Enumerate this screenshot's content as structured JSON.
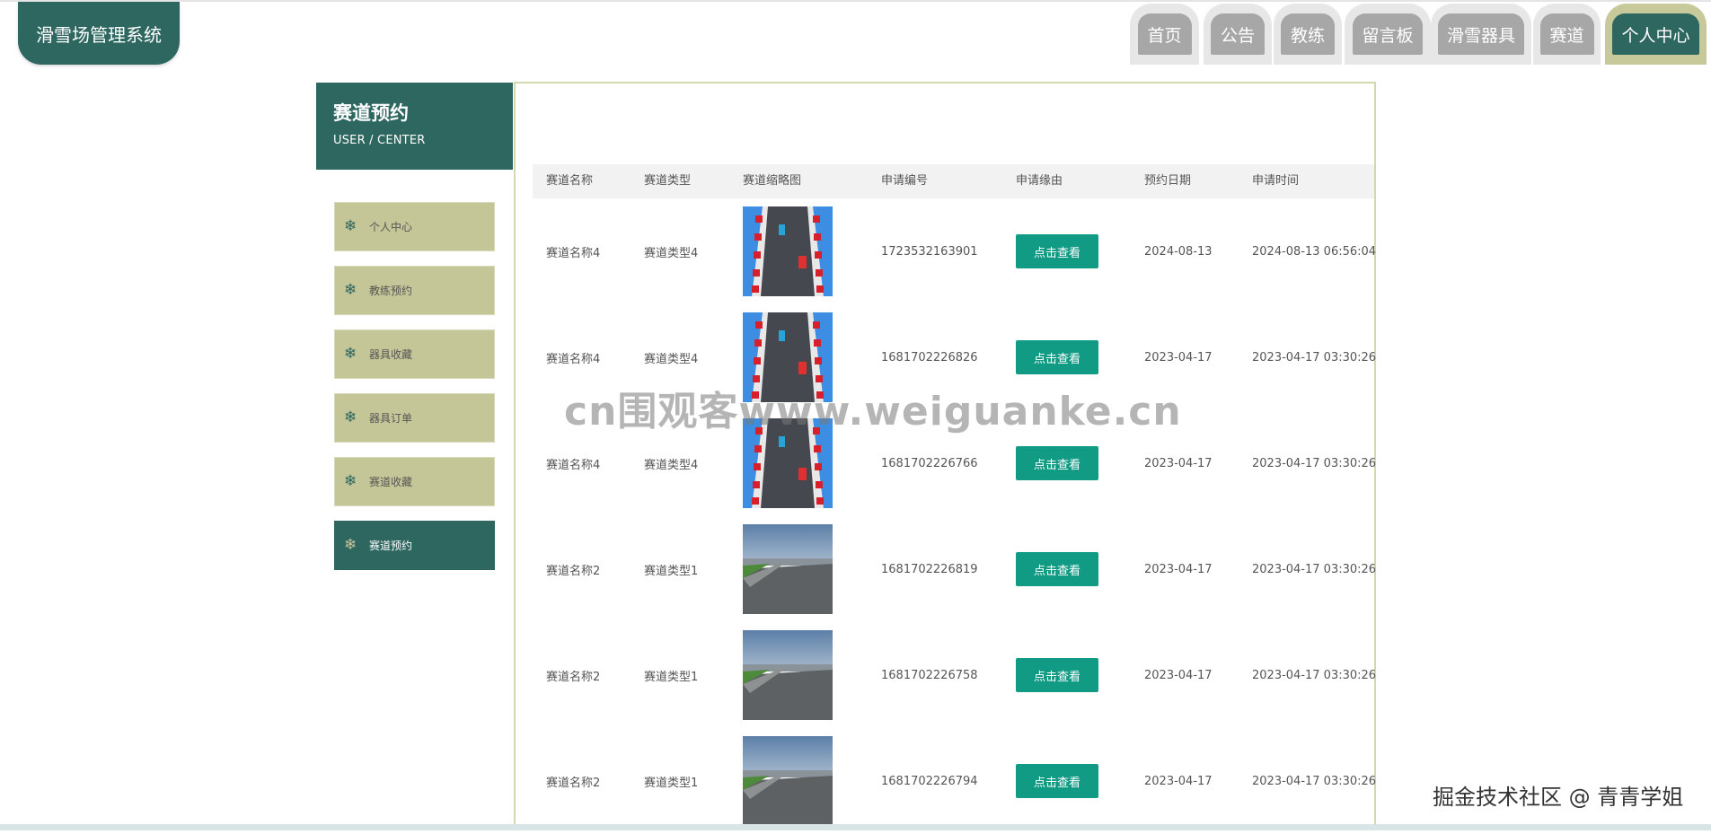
{
  "brand": {
    "title": "滑雪场管理系统"
  },
  "nav": {
    "items": [
      {
        "label": "首页"
      },
      {
        "label": "公告"
      },
      {
        "label": "教练"
      },
      {
        "label": "留言板"
      },
      {
        "label": "滑雪器具"
      },
      {
        "label": "赛道"
      },
      {
        "label": "个人中心",
        "active": true
      }
    ]
  },
  "sidebar": {
    "title": "赛道预约",
    "subtitle": "USER / CENTER",
    "icon": "snowflake-icon",
    "items": [
      {
        "label": "个人中心"
      },
      {
        "label": "教练预约"
      },
      {
        "label": "器具收藏"
      },
      {
        "label": "器具订单"
      },
      {
        "label": "赛道收藏"
      },
      {
        "label": "赛道预约",
        "active": true
      }
    ]
  },
  "table": {
    "headers": [
      "赛道名称",
      "赛道类型",
      "赛道缩略图",
      "申请编号",
      "申请缘由",
      "预约日期",
      "申请时间"
    ],
    "view_label": "点击查看",
    "rows": [
      {
        "name": "赛道名称4",
        "type": "赛道类型4",
        "thumb": "race-track-thumbnail",
        "apply_no": "1723532163901",
        "date": "2024-08-13",
        "time": "2024-08-13 06:56:04"
      },
      {
        "name": "赛道名称4",
        "type": "赛道类型4",
        "thumb": "race-track-thumbnail",
        "apply_no": "1681702226826",
        "date": "2023-04-17",
        "time": "2023-04-17 03:30:26"
      },
      {
        "name": "赛道名称4",
        "type": "赛道类型4",
        "thumb": "race-track-thumbnail",
        "apply_no": "1681702226766",
        "date": "2023-04-17",
        "time": "2023-04-17 03:30:26"
      },
      {
        "name": "赛道名称2",
        "type": "赛道类型1",
        "thumb": "circuit-photo-thumbnail",
        "apply_no": "1681702226819",
        "date": "2023-04-17",
        "time": "2023-04-17 03:30:26"
      },
      {
        "name": "赛道名称2",
        "type": "赛道类型1",
        "thumb": "circuit-photo-thumbnail",
        "apply_no": "1681702226758",
        "date": "2023-04-17",
        "time": "2023-04-17 03:30:26"
      },
      {
        "name": "赛道名称2",
        "type": "赛道类型1",
        "thumb": "circuit-photo-thumbnail",
        "apply_no": "1681702226794",
        "date": "2023-04-17",
        "time": "2023-04-17 03:30:26"
      }
    ]
  },
  "overlay": {
    "watermark": "cn围观客www.weiguanke.cn",
    "credit": "掘金技术社区 @ 青青学姐"
  },
  "colors": {
    "primary": "#2e6660",
    "accent": "#c5c697",
    "button": "#119a84",
    "tab_gray": "#a7a7a7"
  }
}
